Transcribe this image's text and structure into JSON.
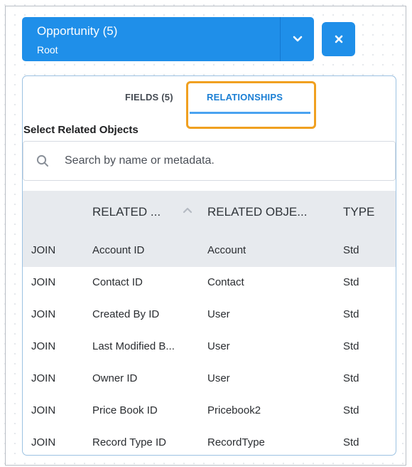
{
  "object": {
    "name": "Opportunity (5)",
    "subtitle": "Root"
  },
  "tabs": {
    "fields": "FIELDS (5)",
    "relationships": "RELATIONSHIPS",
    "active": "relationships"
  },
  "section": {
    "title": "Select Related Objects"
  },
  "search": {
    "placeholder": "Search by name or metadata.",
    "value": ""
  },
  "table": {
    "columns": [
      "",
      "RELATED ...",
      "RELATED OBJE...",
      "TYPE"
    ],
    "sort_column": "RELATED ...",
    "sort_direction": "ascending",
    "rows": [
      [
        "JOIN",
        "Account ID",
        "Account",
        "Std"
      ],
      [
        "JOIN",
        "Contact ID",
        "Contact",
        "Std"
      ],
      [
        "JOIN",
        "Created By ID",
        "User",
        "Std"
      ],
      [
        "JOIN",
        "Last Modified B...",
        "User",
        "Std"
      ],
      [
        "JOIN",
        "Owner ID",
        "User",
        "Std"
      ],
      [
        "JOIN",
        "Price Book ID",
        "Pricebook2",
        "Std"
      ],
      [
        "JOIN",
        "Record Type ID",
        "RecordType",
        "Std"
      ]
    ]
  },
  "colors": {
    "accent": "#1f8fe9",
    "tab_active": "#1b7fd4",
    "highlight": "#f0a020",
    "header_bg": "#e7eaee"
  },
  "icons": {
    "dropdown": "chevron-down-icon",
    "close": "close-icon",
    "search": "search-icon",
    "sort": "sort-ascending-icon"
  }
}
